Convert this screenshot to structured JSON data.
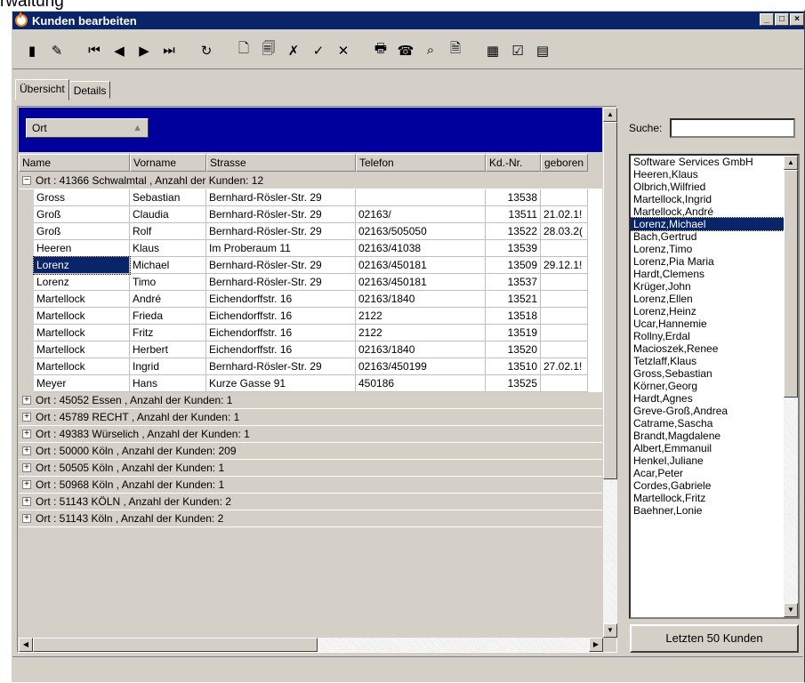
{
  "background_caption": "rwaltung",
  "window": {
    "title": "Kunden bearbeiten",
    "controls": [
      "_",
      "□",
      "×"
    ]
  },
  "toolbar": {
    "buttons": [
      {
        "icon": "exit-door-icon",
        "glyph": "▮"
      },
      {
        "icon": "edit-pen-icon",
        "glyph": "✎"
      },
      {
        "icon": "first-record-icon",
        "glyph": "⏮"
      },
      {
        "icon": "previous-record-icon",
        "glyph": "◀"
      },
      {
        "icon": "next-record-icon",
        "glyph": "▶"
      },
      {
        "icon": "last-record-icon",
        "glyph": "⏭"
      },
      {
        "icon": "refresh-icon",
        "glyph": "↻"
      },
      {
        "icon": "new-record-icon",
        "glyph": "🗋"
      },
      {
        "icon": "copy-record-icon",
        "glyph": "🗐"
      },
      {
        "icon": "delete-record-icon",
        "glyph": "✗"
      },
      {
        "icon": "confirm-icon",
        "glyph": "✓"
      },
      {
        "icon": "cancel-icon",
        "glyph": "✕"
      },
      {
        "icon": "print-icon",
        "glyph": "🖶"
      },
      {
        "icon": "phone-icon",
        "glyph": "☎"
      },
      {
        "icon": "search-binoculars-icon",
        "glyph": "⌕"
      },
      {
        "icon": "document-icon",
        "glyph": "🗎"
      },
      {
        "icon": "excel-export-icon",
        "glyph": "▦"
      },
      {
        "icon": "checkbox-icon",
        "glyph": "☑"
      },
      {
        "icon": "calendar-icon",
        "glyph": "▤"
      }
    ]
  },
  "tabs": [
    {
      "label": "Übersicht",
      "active": true
    },
    {
      "label": "Details",
      "active": false
    }
  ],
  "grid": {
    "group_by": "Ort",
    "columns": [
      "Name",
      "Vorname",
      "Strasse",
      "Telefon",
      "Kd.-Nr.",
      "geboren"
    ],
    "expanded_group": {
      "label": "Ort : 41366 Schwalmtal , Anzahl der Kunden: 12",
      "rows": [
        [
          "Gross",
          "Sebastian",
          "Bernhard-Rösler-Str. 29",
          "",
          "13538",
          ""
        ],
        [
          "Groß",
          "Claudia",
          "Bernhard-Rösler-Str. 29",
          "02163/",
          "13511",
          "21.02.1!"
        ],
        [
          "Groß",
          "Rolf",
          "Bernhard-Rösler-Str. 29",
          "02163/505050",
          "13522",
          "28.03.2("
        ],
        [
          "Heeren",
          "Klaus",
          "Im Proberaum 11",
          "02163/41038",
          "13539",
          ""
        ],
        [
          "Lorenz",
          "Michael",
          "Bernhard-Rösler-Str. 29",
          "02163/450181",
          "13509",
          "29.12.1!"
        ],
        [
          "Lorenz",
          "Timo",
          "Bernhard-Rösler-Str. 29",
          "02163/450181",
          "13537",
          ""
        ],
        [
          "Martellock",
          "André",
          "Eichendorffstr. 16",
          "02163/1840",
          "13521",
          ""
        ],
        [
          "Martellock",
          "Frieda",
          "Eichendorffstr. 16",
          "2122",
          "13518",
          ""
        ],
        [
          "Martellock",
          "Fritz",
          "Eichendorffstr. 16",
          "2122",
          "13519",
          ""
        ],
        [
          "Martellock",
          "Herbert",
          "Eichendorffstr. 16",
          "02163/1840",
          "13520",
          ""
        ],
        [
          "Martellock",
          "Ingrid",
          "Bernhard-Rösler-Str. 29",
          "02163/450199",
          "13510",
          "27.02.1!"
        ],
        [
          "Meyer",
          "Hans",
          "Kurze Gasse 91",
          "450186",
          "13525",
          ""
        ]
      ]
    },
    "collapsed_groups": [
      "Ort : 45052 Essen , Anzahl der Kunden: 1",
      "Ort : 45789 RECHT , Anzahl der Kunden: 1",
      "Ort : 49383 Würselich , Anzahl der Kunden: 1",
      "Ort : 50000 Köln , Anzahl der Kunden: 209",
      "Ort : 50505 Köln , Anzahl der Kunden: 1",
      "Ort : 50968 Köln , Anzahl der Kunden: 1",
      "Ort : 51143 KÖLN , Anzahl der Kunden: 2",
      "Ort : 51143 Köln , Anzahl der Kunden: 2"
    ]
  },
  "sidebar": {
    "search_label": "Suche:",
    "search_value": "",
    "list": [
      "Software Services GmbH",
      "Heeren,Klaus",
      "Olbrich,Wilfried",
      "Martellock,Ingrid",
      "Martellock,André",
      "Lorenz,Michael",
      "Bach,Gertrud",
      "Lorenz,Timo",
      "Lorenz,Pia Maria",
      "Hardt,Clemens",
      "Krüger,John",
      "Lorenz,Ellen",
      "Lorenz,Heinz",
      "Ucar,Hannemie",
      "Rollny,Erdal",
      "Macioszek,Renee",
      "Tetzlaff,Klaus",
      "Gross,Sebastian",
      "Körner,Georg",
      "Hardt,Agnes",
      "Greve-Groß,Andrea",
      "Catrame,Sascha",
      "Brandt,Magdalene",
      "Albert,Emmanuil",
      "Henkel,Juliane",
      "Acar,Peter",
      "Cordes,Gabriele",
      "Martellock,Fritz",
      "Baehner,Lonie"
    ],
    "selected_list_item": "Lorenz,Michael",
    "last_customers_button": "Letzten 50 Kunden"
  }
}
